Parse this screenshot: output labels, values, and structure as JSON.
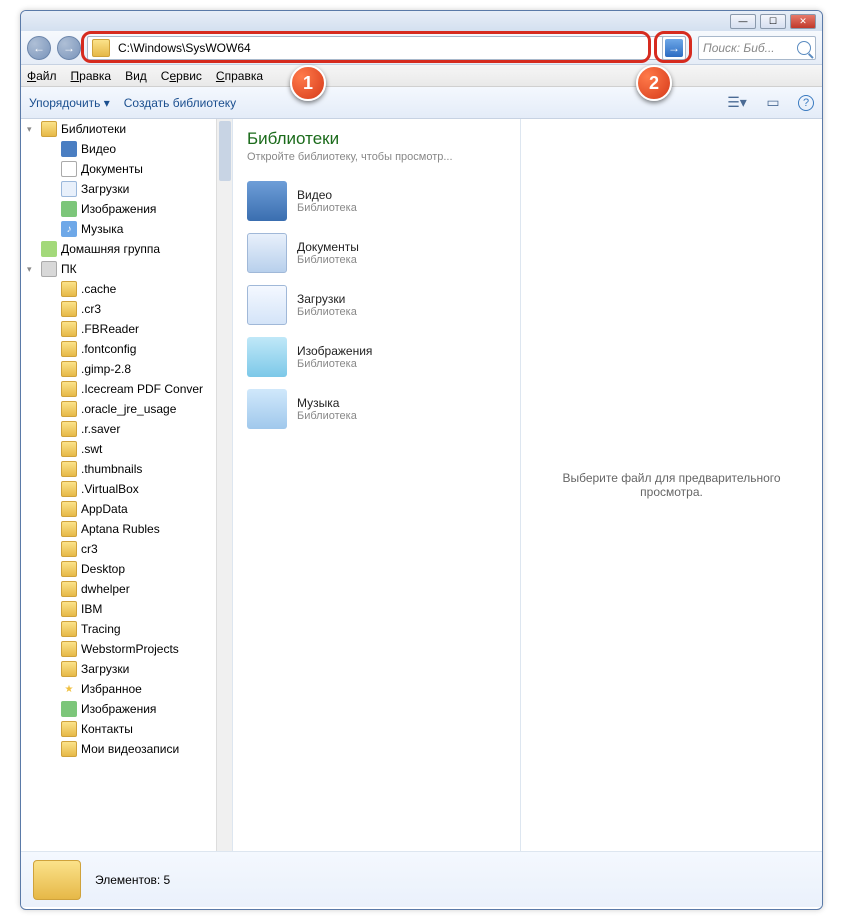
{
  "titlebar": {
    "min": "—",
    "max": "☐",
    "close": "✕"
  },
  "nav": {
    "back": "←",
    "fwd": "→",
    "address": "C:\\Windows\\SysWOW64",
    "go": "→",
    "search_placeholder": "Поиск: Биб..."
  },
  "menu": {
    "file": "Файл",
    "edit": "Правка",
    "view": "Вид",
    "tools": "Сервис",
    "help": "Справка"
  },
  "toolbar": {
    "organize": "Упорядочить ▾",
    "newlib": "Создать библиотеку",
    "view_icon": "☰▾",
    "preview_icon": "▭",
    "help_icon": "?"
  },
  "tree": [
    {
      "d": 0,
      "exp": "▾",
      "ic": "lib",
      "t": "Библиотеки"
    },
    {
      "d": 1,
      "exp": "",
      "ic": "vid",
      "t": "Видео"
    },
    {
      "d": 1,
      "exp": "",
      "ic": "doc",
      "t": "Документы"
    },
    {
      "d": 1,
      "exp": "",
      "ic": "dl",
      "t": "Загрузки"
    },
    {
      "d": 1,
      "exp": "",
      "ic": "img",
      "t": "Изображения"
    },
    {
      "d": 1,
      "exp": "",
      "ic": "mus",
      "t": "Музыка"
    },
    {
      "d": 0,
      "exp": "",
      "ic": "home",
      "t": "Домашняя группа"
    },
    {
      "d": 0,
      "exp": "▾",
      "ic": "pc",
      "t": "ПК"
    },
    {
      "d": 1,
      "exp": "",
      "ic": "fold",
      "t": ".cache"
    },
    {
      "d": 1,
      "exp": "",
      "ic": "fold",
      "t": ".cr3"
    },
    {
      "d": 1,
      "exp": "",
      "ic": "fold",
      "t": ".FBReader"
    },
    {
      "d": 1,
      "exp": "",
      "ic": "fold",
      "t": ".fontconfig"
    },
    {
      "d": 1,
      "exp": "",
      "ic": "fold",
      "t": ".gimp-2.8"
    },
    {
      "d": 1,
      "exp": "",
      "ic": "fold",
      "t": ".Icecream PDF Conver"
    },
    {
      "d": 1,
      "exp": "",
      "ic": "fold",
      "t": ".oracle_jre_usage"
    },
    {
      "d": 1,
      "exp": "",
      "ic": "fold",
      "t": ".r.saver"
    },
    {
      "d": 1,
      "exp": "",
      "ic": "fold",
      "t": ".swt"
    },
    {
      "d": 1,
      "exp": "",
      "ic": "fold",
      "t": ".thumbnails"
    },
    {
      "d": 1,
      "exp": "",
      "ic": "fold",
      "t": ".VirtualBox"
    },
    {
      "d": 1,
      "exp": "",
      "ic": "fold",
      "t": "AppData"
    },
    {
      "d": 1,
      "exp": "",
      "ic": "fold",
      "t": "Aptana Rubles"
    },
    {
      "d": 1,
      "exp": "",
      "ic": "fold",
      "t": "cr3"
    },
    {
      "d": 1,
      "exp": "",
      "ic": "fold",
      "t": "Desktop"
    },
    {
      "d": 1,
      "exp": "",
      "ic": "fold",
      "t": "dwhelper"
    },
    {
      "d": 1,
      "exp": "",
      "ic": "fold",
      "t": "IBM"
    },
    {
      "d": 1,
      "exp": "",
      "ic": "fold",
      "t": "Tracing"
    },
    {
      "d": 1,
      "exp": "",
      "ic": "fold",
      "t": "WebstormProjects"
    },
    {
      "d": 1,
      "exp": "",
      "ic": "fold",
      "t": "Загрузки"
    },
    {
      "d": 1,
      "exp": "",
      "ic": "star",
      "t": "Избранное"
    },
    {
      "d": 1,
      "exp": "",
      "ic": "img",
      "t": "Изображения"
    },
    {
      "d": 1,
      "exp": "",
      "ic": "fold",
      "t": "Контакты"
    },
    {
      "d": 1,
      "exp": "",
      "ic": "fold",
      "t": "Мои видеозаписи"
    }
  ],
  "main": {
    "title": "Библиотеки",
    "subtitle": "Откройте библиотеку, чтобы просмотр...",
    "items": [
      {
        "ic": "bi-vid",
        "nm": "Видео",
        "ty": "Библиотека"
      },
      {
        "ic": "bi-doc",
        "nm": "Документы",
        "ty": "Библиотека"
      },
      {
        "ic": "bi-dl",
        "nm": "Загрузки",
        "ty": "Библиотека"
      },
      {
        "ic": "bi-img",
        "nm": "Изображения",
        "ty": "Библиотека"
      },
      {
        "ic": "bi-mus",
        "nm": "Музыка",
        "ty": "Библиотека"
      }
    ],
    "preview_empty": "Выберите файл для предварительного просмотра."
  },
  "status": {
    "count": "Элементов: 5"
  },
  "callouts": {
    "one": "1",
    "two": "2"
  }
}
